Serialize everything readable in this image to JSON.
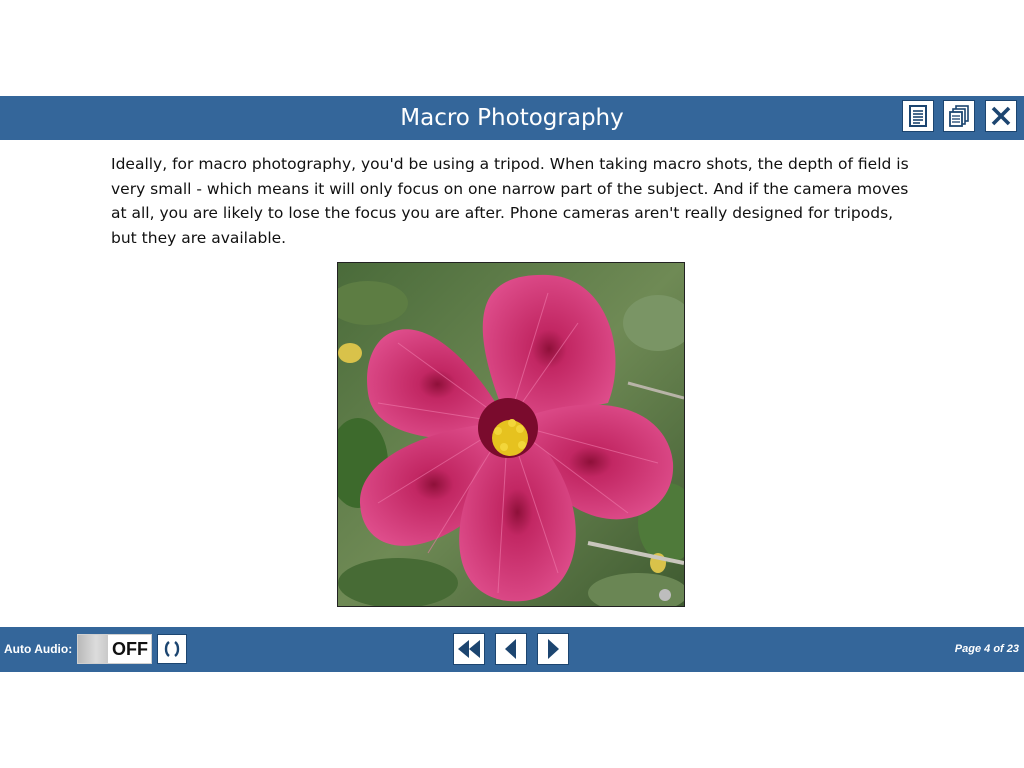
{
  "header": {
    "title": "Macro Photography"
  },
  "header_buttons": {
    "icons": [
      "document-icon",
      "copy-pages-icon",
      "close-icon"
    ]
  },
  "content": {
    "paragraph": "Ideally, for macro photography, you'd be using a tripod. When taking macro shots, the depth of field is very small - which means it will only focus on one narrow part of the subject. And if the camera moves at all, you are likely to lose the focus you are after. Phone cameras aren't really designed for tripods, but they are available."
  },
  "footer": {
    "auto_audio_label": "Auto Audio:",
    "auto_audio_state": "OFF",
    "page_info": "Page 4 of 23"
  },
  "colors": {
    "bar": "#34669a",
    "button_border": "#1c4570",
    "icon": "#1c4570",
    "flower": "#d63a7c"
  }
}
